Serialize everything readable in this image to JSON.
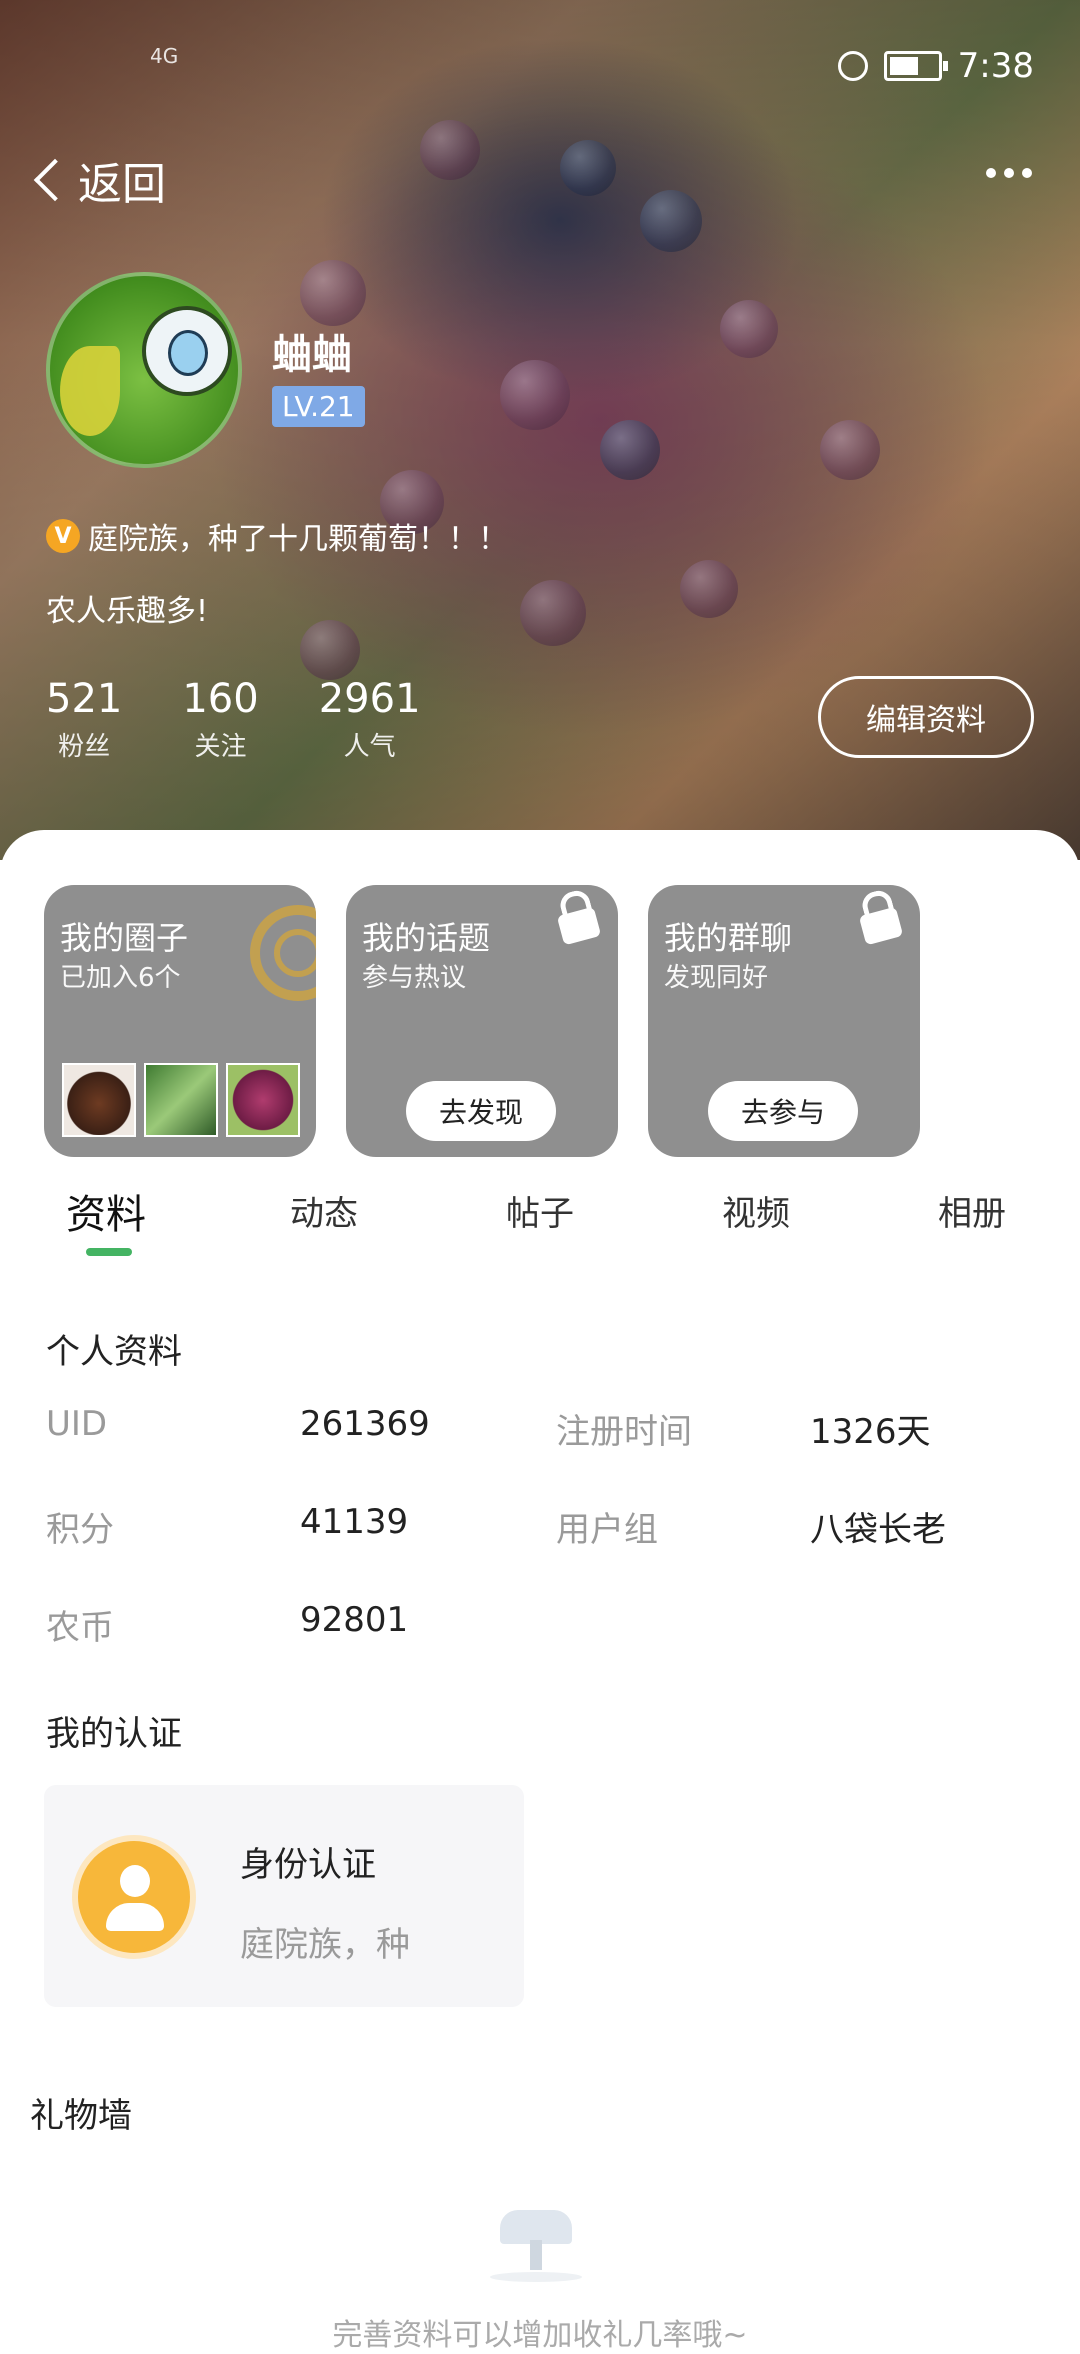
{
  "status_bar": {
    "network": "4G",
    "time": "7:38"
  },
  "nav": {
    "back_label": "返回"
  },
  "profile": {
    "username": "蛐蛐",
    "level": "LV.21",
    "bio_line1": "庭院族，种了十几颗葡萄！！！",
    "bio_line2": "农人乐趣多!",
    "stats": [
      {
        "value": "521",
        "label": "粉丝"
      },
      {
        "value": "160",
        "label": "关注"
      },
      {
        "value": "2961",
        "label": "人气"
      }
    ],
    "edit_button": "编辑资料"
  },
  "cards": [
    {
      "title": "我的圈子",
      "subtitle": "已加入6个"
    },
    {
      "title": "我的话题",
      "subtitle": "参与热议",
      "button": "去发现"
    },
    {
      "title": "我的群聊",
      "subtitle": "发现同好",
      "button": "去参与"
    }
  ],
  "tabs": [
    "资料",
    "动态",
    "帖子",
    "视频",
    "相册"
  ],
  "active_tab": "资料",
  "personal_info": {
    "title": "个人资料",
    "rows": [
      {
        "label": "UID",
        "value": "261369"
      },
      {
        "label": "注册时间",
        "value": "1326天"
      },
      {
        "label": "积分",
        "value": "41139"
      },
      {
        "label": "用户组",
        "value": "八袋长老"
      },
      {
        "label": "农币",
        "value": "92801"
      }
    ]
  },
  "certification": {
    "title": "我的认证",
    "card_title": "身份认证",
    "card_subtitle": "庭院族，种"
  },
  "gift_wall": {
    "title": "礼物墙",
    "empty_tip": "完善资料可以增加收礼几率哦~"
  },
  "colors": {
    "accent_green": "#44b463",
    "level_badge": "#7fa9e6",
    "card_gray": "#8f8f8f",
    "auth_orange": "#f7b73a"
  }
}
